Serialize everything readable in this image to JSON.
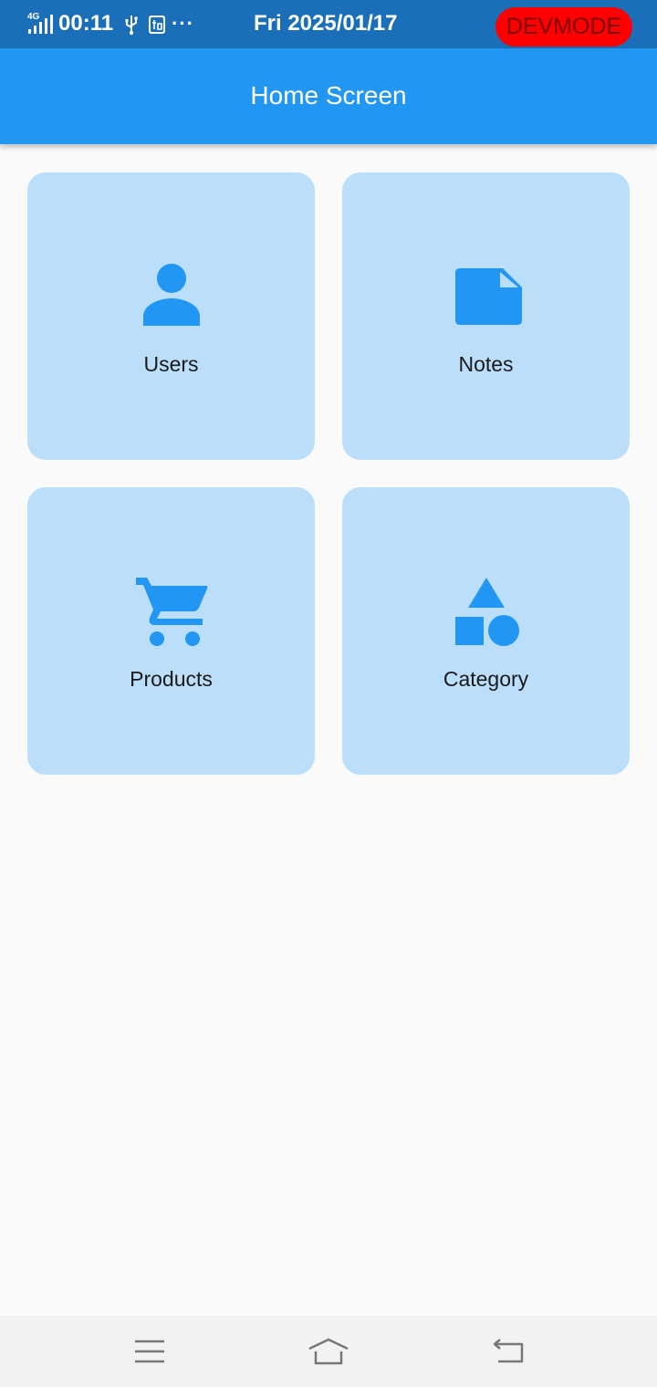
{
  "status_bar": {
    "network": "4G",
    "time": "00:11",
    "more": "···",
    "date": "Fri 2025/01/17",
    "devmode": "DEVMODE"
  },
  "app_bar": {
    "title": "Home Screen"
  },
  "tiles": [
    {
      "label": "Users",
      "icon": "person-icon"
    },
    {
      "label": "Notes",
      "icon": "note-icon"
    },
    {
      "label": "Products",
      "icon": "shopping-cart-icon"
    },
    {
      "label": "Category",
      "icon": "category-shapes-icon"
    }
  ],
  "nav_bar": {
    "menu_icon": "menu-icon",
    "home_icon": "home-icon",
    "back_icon": "back-icon"
  },
  "colors": {
    "status_bar": "#1b6fb8",
    "app_bar": "#2196f3",
    "tile_background": "#bbdefb",
    "icon": "#2196f3",
    "devmode_badge": "#ff0000",
    "page_background": "#fafafa"
  }
}
